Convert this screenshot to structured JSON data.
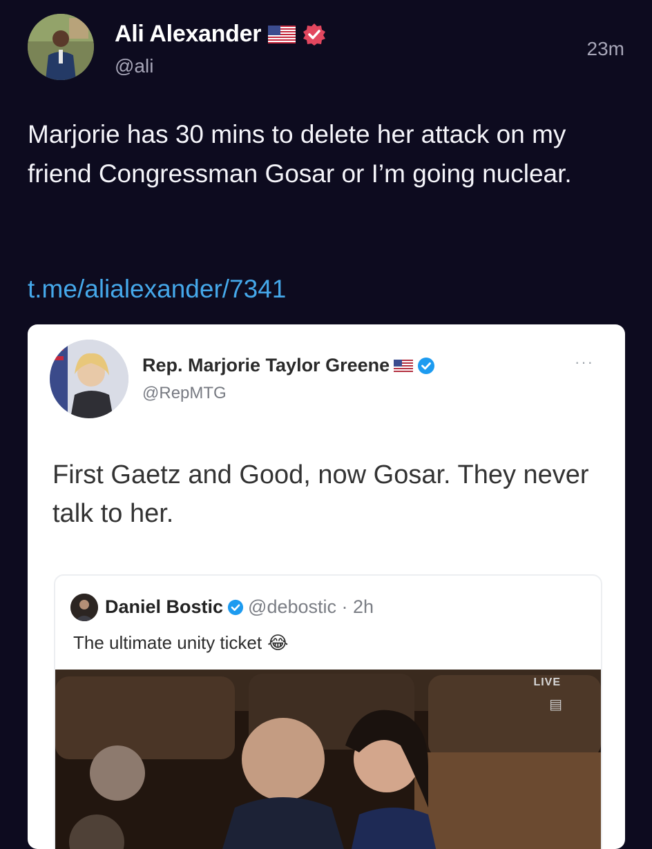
{
  "post": {
    "author_name": "Ali Alexander",
    "author_handle": "@ali",
    "time": "23m",
    "flag_icon": "us-flag-icon",
    "verified_icon": "verified-badge-icon",
    "text": "Marjorie has 30 mins to delete her attack on my friend Congressman Gosar or I’m going nuclear.",
    "link": "t.me/alialexander/7341"
  },
  "embedded_tweet": {
    "author_name": "Rep. Marjorie Taylor Greene",
    "author_handle": "@RepMTG",
    "more_label": "···",
    "text": "First Gaetz and Good, now Gosar. They never talk to her.",
    "quoted": {
      "author_name": "Daniel Bostic",
      "author_handle": "@debostic · 2h",
      "text": "The ultimate unity ticket",
      "emoji": "😂",
      "media_badge_live": "LIVE"
    }
  },
  "colors": {
    "background": "#0d0b1f",
    "link": "#45a8ea",
    "verified_pink": "#e2475f",
    "verified_blue": "#1d9bf0"
  }
}
